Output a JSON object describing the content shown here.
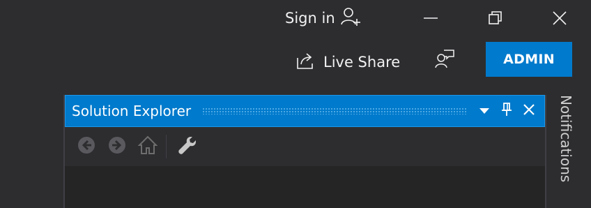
{
  "titlebar": {
    "sign_in_label": "Sign in",
    "icons": {
      "account": "add-person-icon",
      "minimize": "minimize-icon",
      "restore": "restore-icon",
      "close": "close-icon"
    }
  },
  "commandbar": {
    "live_share_label": "Live Share",
    "admin_label": "ADMIN",
    "icons": {
      "live_share": "share-icon",
      "feedback": "feedback-icon"
    }
  },
  "solution_explorer": {
    "title": "Solution Explorer",
    "header_icons": [
      "dropdown-icon",
      "pin-icon",
      "close-icon"
    ],
    "toolbar_icons": [
      "back-icon",
      "forward-icon",
      "home-icon",
      "properties-wrench-icon"
    ]
  },
  "side_tabs": {
    "notifications_label": "Notifications"
  },
  "colors": {
    "background": "#2d2d30",
    "accent": "#007acc",
    "text": "#f1f1f1",
    "disabled": "#6d6d6d"
  }
}
